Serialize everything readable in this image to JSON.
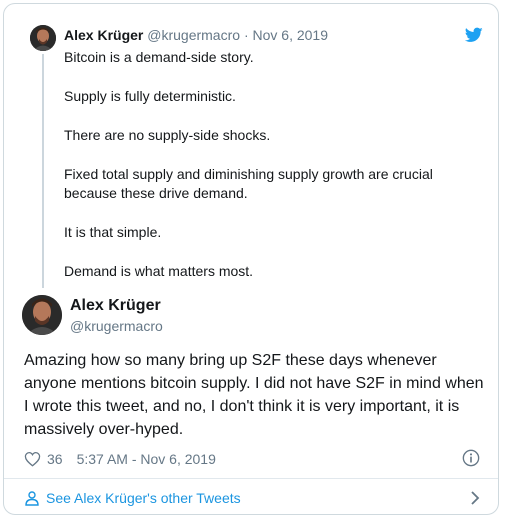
{
  "quoted_tweet": {
    "author_name": "Alex Krüger",
    "author_handle": "@krugermacro",
    "separator": "·",
    "date": "Nov 6, 2019",
    "paragraphs": [
      "Bitcoin is a demand-side story.",
      "Supply is fully deterministic.",
      "There are no supply-side shocks.",
      "Fixed total supply and diminishing supply growth are crucial because these drive demand.",
      "It is that simple.",
      "Demand is what matters most."
    ]
  },
  "tweet": {
    "author_name": "Alex Krüger",
    "author_handle": "@krugermacro",
    "text": "Amazing how so many bring up S2F these days whenever anyone mentions bitcoin supply. I did not have S2F in mind when I wrote this tweet, and no, I don't think it is very important, it is massively over-hyped.",
    "likes": "36",
    "timestamp": "5:37 AM - Nov 6, 2019"
  },
  "footer": {
    "link_label": "See Alex Krüger's other Tweets"
  },
  "colors": {
    "accent": "#1da1f2",
    "link": "#1b95e0",
    "secondary_text": "#657786",
    "border": "#cfd9de"
  },
  "icons": [
    "avatar",
    "twitter-bird-icon",
    "heart-icon",
    "info-icon",
    "user-icon",
    "chevron-right-icon"
  ]
}
